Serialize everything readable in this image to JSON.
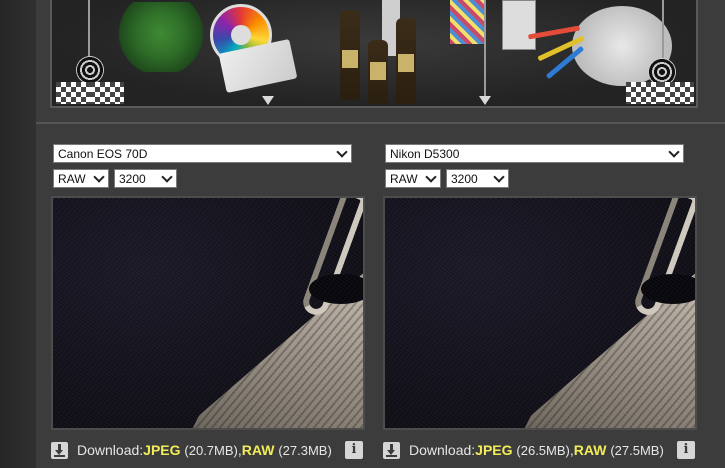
{
  "left": {
    "camera_select": "Canon EOS 70D",
    "format_select": "RAW",
    "iso_select": "3200",
    "download": {
      "prefix": "Download: ",
      "jpeg_label": "JPEG",
      "jpeg_size": "(20.7MB)",
      "separator": ", ",
      "raw_label": "RAW",
      "raw_size": "(27.3MB)"
    },
    "info_glyph": "i"
  },
  "right": {
    "camera_select": "Nikon D5300",
    "format_select": "RAW",
    "iso_select": "3200",
    "download": {
      "prefix": "Download: ",
      "jpeg_label": "JPEG",
      "jpeg_size": "(26.5MB)",
      "separator": ", ",
      "raw_label": "RAW",
      "raw_size": "(27.5MB)"
    },
    "info_glyph": "i"
  },
  "icons": {
    "download": "download-icon",
    "info": "info-icon",
    "dropdown": "chevron-down-icon"
  },
  "colors": {
    "panel_bg": "#3c3c3c",
    "highlight": "#f2ec5a",
    "text": "#e6e6e6"
  }
}
